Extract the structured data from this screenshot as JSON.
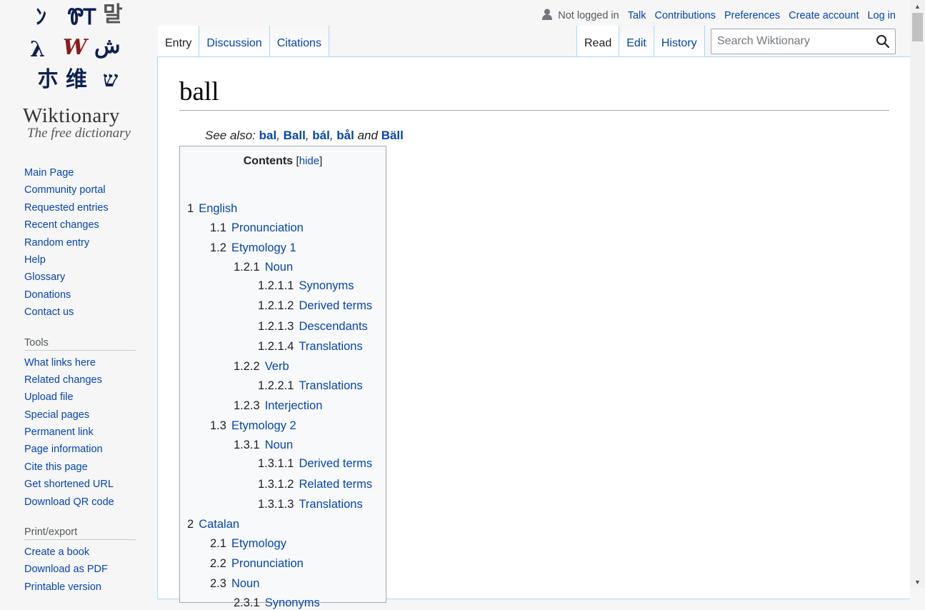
{
  "logo": {
    "glyphs": [
      "ﾝ",
      "ᏈᎢ",
      "말",
      "λ",
      "W",
      "ش",
      "朩",
      "维",
      "ש"
    ],
    "title": "Wiktionary",
    "tagline": "The free dictionary"
  },
  "sidebar": {
    "navigation": [
      "Main Page",
      "Community portal",
      "Requested entries",
      "Recent changes",
      "Random entry",
      "Help",
      "Glossary",
      "Donations",
      "Contact us"
    ],
    "tools_heading": "Tools",
    "tools": [
      "What links here",
      "Related changes",
      "Upload file",
      "Special pages",
      "Permanent link",
      "Page information",
      "Cite this page",
      "Get shortened URL",
      "Download QR code"
    ],
    "print_heading": "Print/export",
    "print": [
      "Create a book",
      "Download as PDF",
      "Printable version"
    ]
  },
  "personal": {
    "user_icon": "user-icon",
    "anon": "Not logged in",
    "talk": "Talk",
    "contributions": "Contributions",
    "preferences": "Preferences",
    "create_account": "Create account",
    "log_in": "Log in"
  },
  "tabs": {
    "entry": "Entry",
    "discussion": "Discussion",
    "citations": "Citations",
    "read": "Read",
    "edit": "Edit",
    "history": "History"
  },
  "search": {
    "placeholder": "Search Wiktionary",
    "icon": "search-icon"
  },
  "page": {
    "title": "ball",
    "see_also_label": "See also:",
    "see_also": [
      "bal",
      "Ball",
      "bál",
      "bål",
      "Bäll"
    ],
    "see_also_and": "and"
  },
  "toc": {
    "title": "Contents",
    "hide": "hide",
    "items": [
      {
        "num": "1",
        "label": "English",
        "level": 1
      },
      {
        "num": "1.1",
        "label": "Pronunciation",
        "level": 2
      },
      {
        "num": "1.2",
        "label": "Etymology 1",
        "level": 2
      },
      {
        "num": "1.2.1",
        "label": "Noun",
        "level": 3
      },
      {
        "num": "1.2.1.1",
        "label": "Synonyms",
        "level": 4
      },
      {
        "num": "1.2.1.2",
        "label": "Derived terms",
        "level": 4
      },
      {
        "num": "1.2.1.3",
        "label": "Descendants",
        "level": 4
      },
      {
        "num": "1.2.1.4",
        "label": "Translations",
        "level": 4
      },
      {
        "num": "1.2.2",
        "label": "Verb",
        "level": 3
      },
      {
        "num": "1.2.2.1",
        "label": "Translations",
        "level": 4
      },
      {
        "num": "1.2.3",
        "label": "Interjection",
        "level": 3
      },
      {
        "num": "1.3",
        "label": "Etymology 2",
        "level": 2
      },
      {
        "num": "1.3.1",
        "label": "Noun",
        "level": 3
      },
      {
        "num": "1.3.1.1",
        "label": "Derived terms",
        "level": 4
      },
      {
        "num": "1.3.1.2",
        "label": "Related terms",
        "level": 4
      },
      {
        "num": "1.3.1.3",
        "label": "Translations",
        "level": 4
      },
      {
        "num": "2",
        "label": "Catalan",
        "level": 1
      },
      {
        "num": "2.1",
        "label": "Etymology",
        "level": 2
      },
      {
        "num": "2.2",
        "label": "Pronunciation",
        "level": 2
      },
      {
        "num": "2.3",
        "label": "Noun",
        "level": 2
      },
      {
        "num": "2.3.1",
        "label": "Synonyms",
        "level": 3
      }
    ]
  },
  "colors": {
    "link": "#0645ad",
    "text": "#202122",
    "border": "#a7d7f9"
  }
}
